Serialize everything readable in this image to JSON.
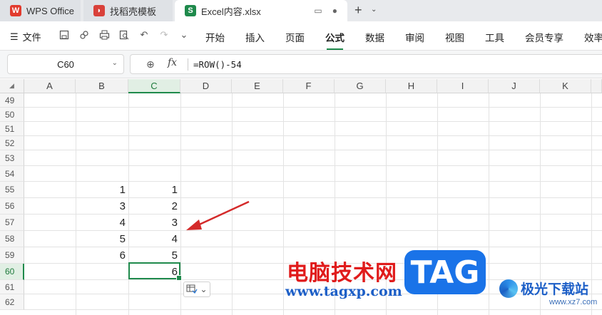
{
  "tabs": [
    {
      "label": "WPS Office",
      "icon": "wps-logo-icon"
    },
    {
      "label": "找稻壳模板",
      "icon": "template-icon"
    },
    {
      "label": "Excel内容.xlsx",
      "icon": "spreadsheet-icon",
      "icon_letter": "S",
      "active": true
    }
  ],
  "menu": {
    "file_label": "文件",
    "items": [
      "开始",
      "插入",
      "页面",
      "公式",
      "数据",
      "审阅",
      "视图",
      "工具",
      "会员专享",
      "效率"
    ],
    "active": "公式"
  },
  "formula_bar": {
    "name_box": "C60",
    "fx_label": "fx",
    "formula": "=ROW()-54"
  },
  "grid": {
    "columns": [
      "A",
      "B",
      "C",
      "D",
      "E",
      "F",
      "G",
      "H",
      "I",
      "J",
      "K"
    ],
    "selected_column": "C",
    "rows": [
      "49",
      "50",
      "51",
      "52",
      "53",
      "54",
      "55",
      "56",
      "57",
      "58",
      "59",
      "60",
      "61",
      "62"
    ],
    "selected_row": "60",
    "column_b_values": [
      "1",
      "3",
      "4",
      "5",
      "6"
    ],
    "column_c_values": [
      "1",
      "2",
      "3",
      "4",
      "5",
      "6"
    ]
  },
  "watermark": {
    "text_cn": "电脑技术网",
    "url": "www.tagxp.com",
    "tag": "TAG",
    "site_cn": "极光下载站",
    "site_url": "www.xz7.com"
  },
  "colors": {
    "accent": "#1f8a4c",
    "arrow": "#d42a2a"
  }
}
